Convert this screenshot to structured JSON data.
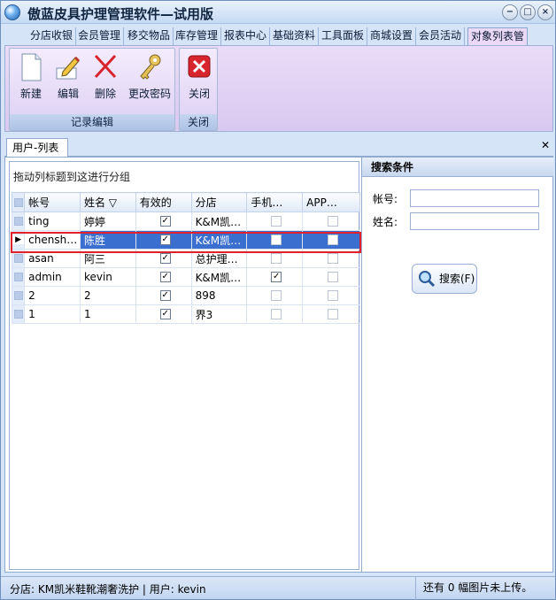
{
  "window": {
    "title": "傲蓝皮具护理管理软件—试用版"
  },
  "menu": {
    "tabs": [
      "分店收银",
      "会员管理",
      "移交物品",
      "库存管理",
      "报表中心",
      "基础资料",
      "工具面板",
      "商城设置",
      "会员活动",
      "对象列表管"
    ],
    "active_index": 9
  },
  "ribbon": {
    "groups": [
      {
        "label": "记录编辑",
        "buttons": [
          "新建",
          "编辑",
          "删除",
          "更改密码"
        ]
      },
      {
        "label": "关闭",
        "buttons": [
          "关闭"
        ]
      }
    ]
  },
  "doc_tab": {
    "label": "用户-列表"
  },
  "grid": {
    "group_hint": "拖动列标题到这进行分组",
    "columns": [
      "帐号",
      "姓名 ▽",
      "有效的",
      "分店",
      "手机…",
      "APP…"
    ],
    "rows": [
      {
        "account": "ting",
        "name": "婷婷",
        "valid": true,
        "store": "K&M凯…",
        "mobile": false,
        "app": false
      },
      {
        "account": "chensh…",
        "name": "陈胜",
        "valid": true,
        "store": "K&M凯…",
        "mobile": false,
        "app": false
      },
      {
        "account": "asan",
        "name": "阿三",
        "valid": true,
        "store": "总护理…",
        "mobile": false,
        "app": false
      },
      {
        "account": "admin",
        "name": "kevin",
        "valid": true,
        "store": "K&M凯…",
        "mobile": true,
        "app": false
      },
      {
        "account": "2",
        "name": "2",
        "valid": true,
        "store": "898",
        "mobile": false,
        "app": false
      },
      {
        "account": "1",
        "name": "1",
        "valid": true,
        "store": "界3",
        "mobile": false,
        "app": false
      }
    ],
    "selected_index": 1
  },
  "search": {
    "title": "搜索条件",
    "account_label": "帐号:",
    "name_label": "姓名:",
    "account_value": "",
    "name_value": "",
    "button_label": "搜索(F)"
  },
  "status": {
    "left": "分店: KM凯米鞋靴潮奢洗护  | 用户: kevin",
    "right": "还有 0 幅图片未上传。"
  },
  "colors": {
    "selection": "#3a6fcf",
    "highlight_outline": "#e0202a",
    "close_icon": "#d8242c"
  }
}
